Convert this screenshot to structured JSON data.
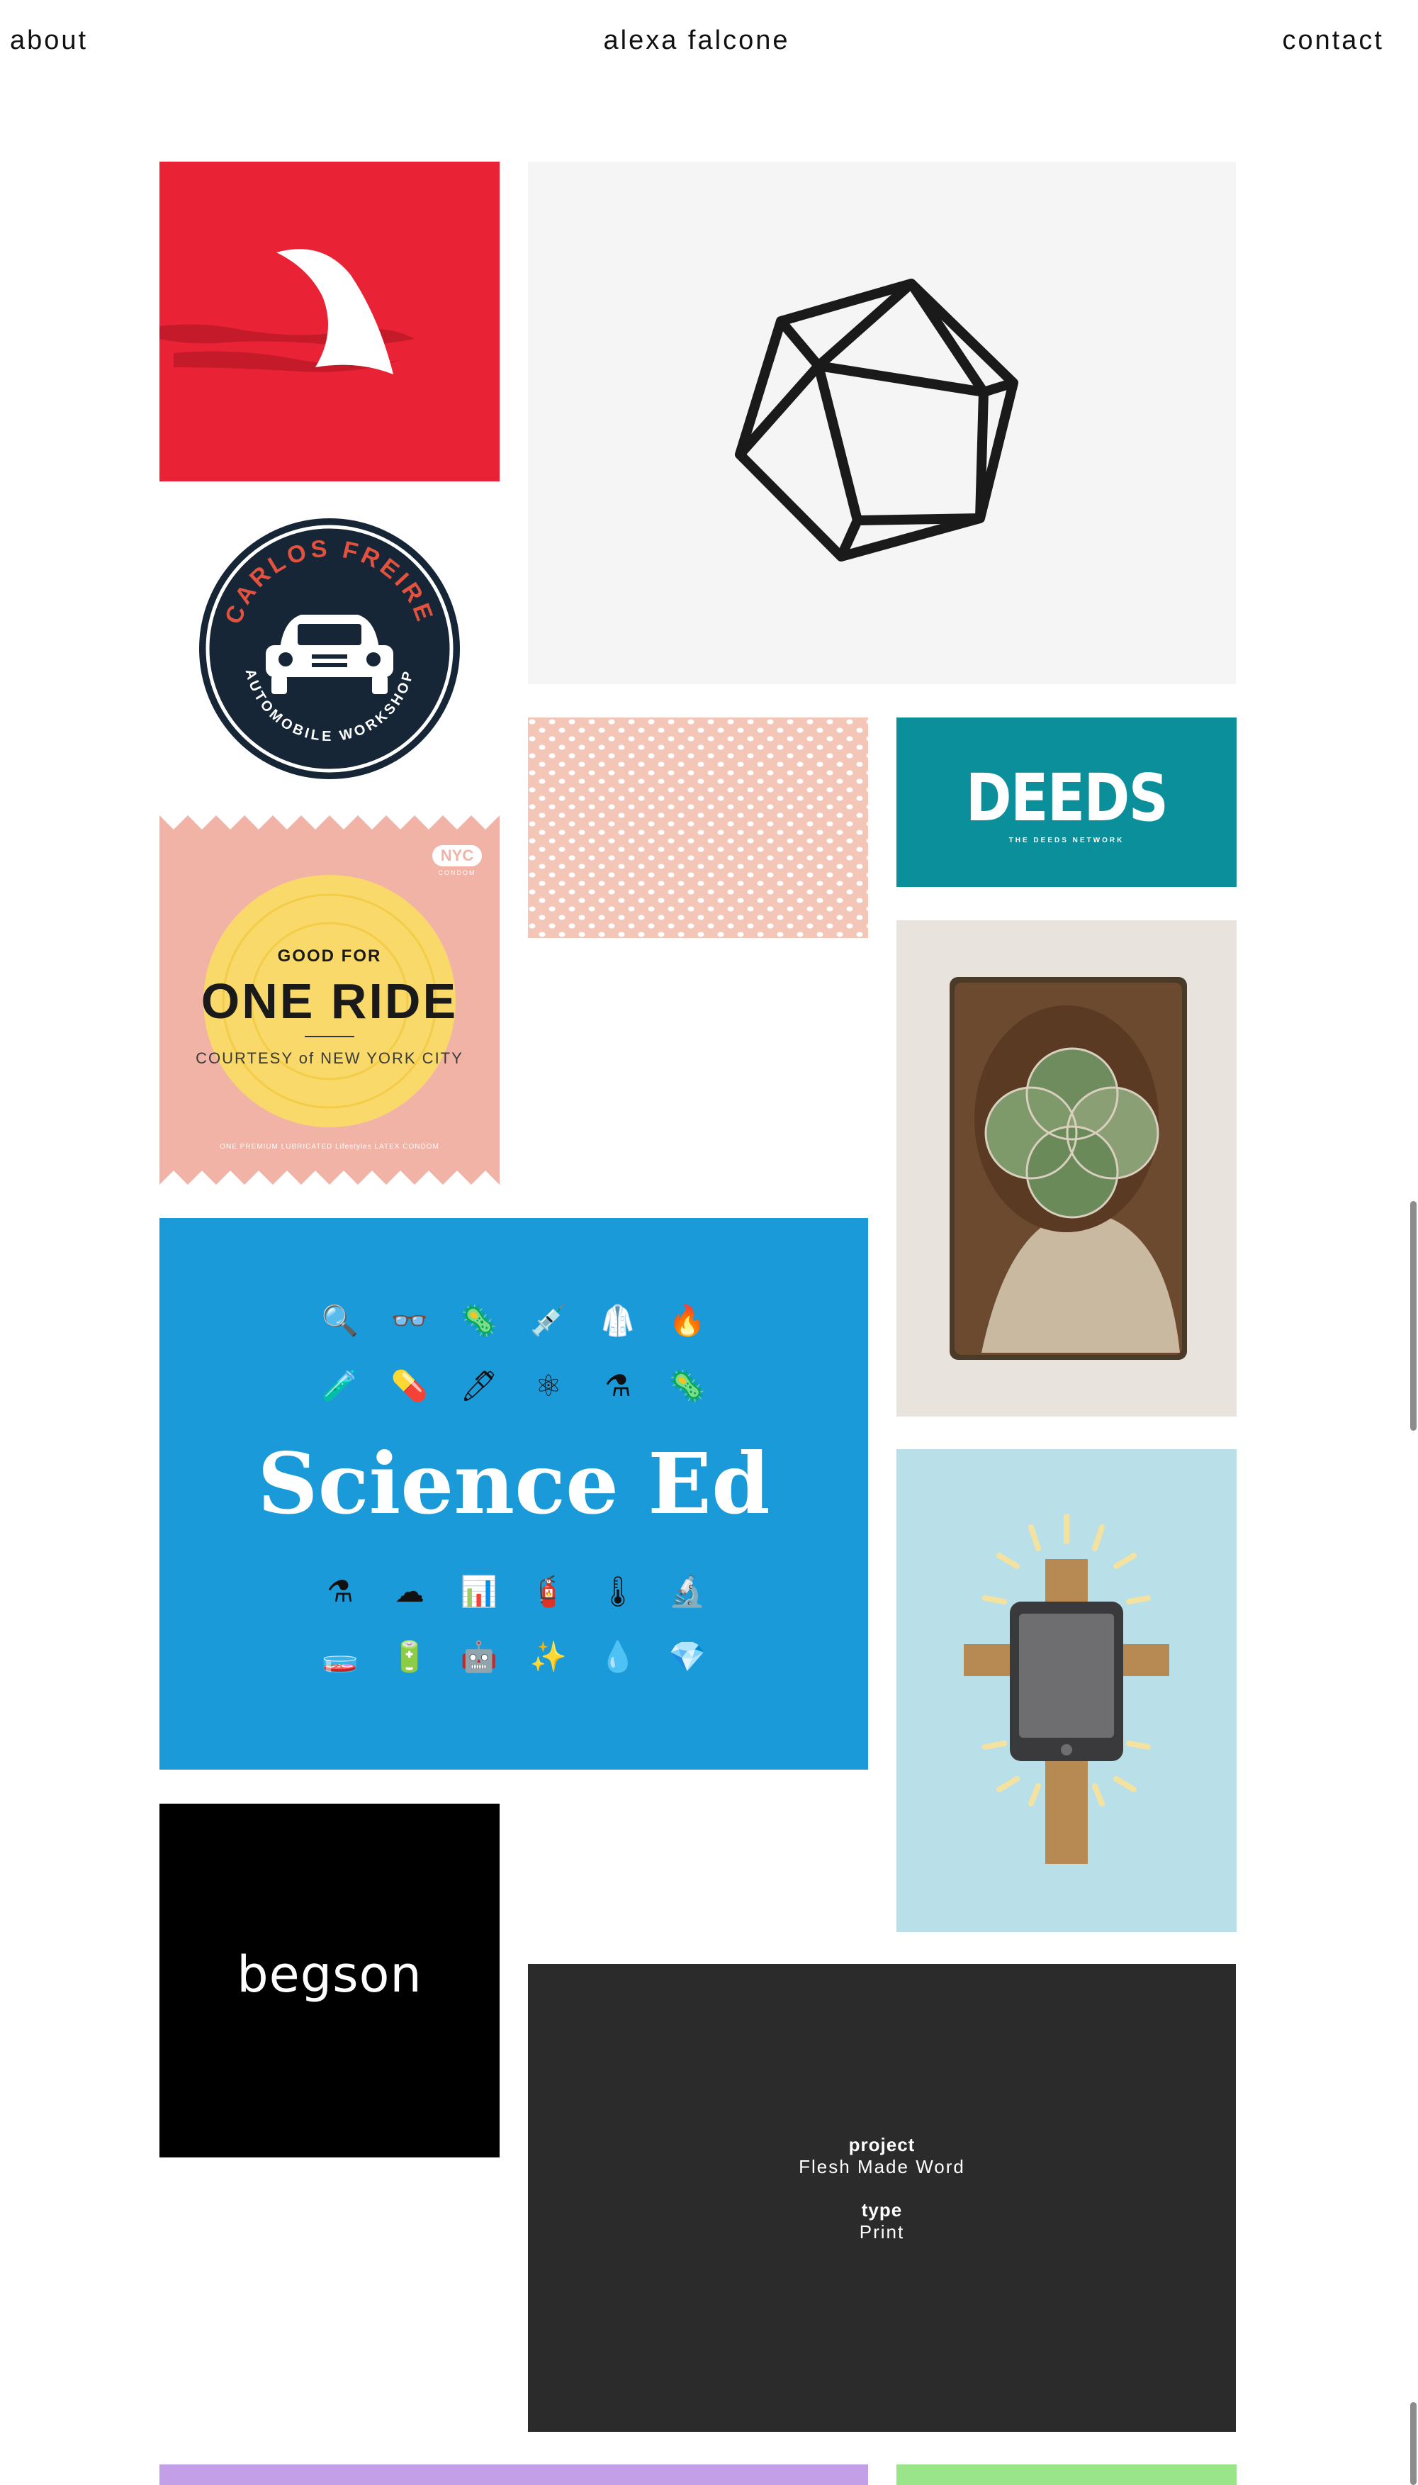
{
  "header": {
    "about": "about",
    "title": "alexa falcone",
    "contact": "contact"
  },
  "tiles": {
    "carlos": {
      "top": "CARLOS FREIRE",
      "bottom": "AUTOMOBILE WORKSHOP"
    },
    "deeds": {
      "title": "DEEDS",
      "subtitle": "THE DEEDS NETWORK"
    },
    "ride": {
      "badge": "NYC",
      "badge_sub": "CONDOM",
      "good_for": "GOOD FOR",
      "one_ride": "ONE RIDE",
      "courtesy": "COURTESY of NEW YORK CITY",
      "footer": "ONE PREMIUM LUBRICATED Lifestyles LATEX CONDOM"
    },
    "science": {
      "title": "Science Ed",
      "icons_row1": [
        "🔍",
        "👓",
        "🦠",
        "💉",
        "🥼",
        "🔥"
      ],
      "icons_row2": [
        "🧪",
        "💊",
        "🖊",
        "⚛",
        "⚗",
        "🦠"
      ],
      "icons_row3": [
        "⚗",
        "☁",
        "📊",
        "🧯",
        "🌡",
        "🔬"
      ],
      "icons_row4": [
        "🧫",
        "🔋",
        "🤖",
        "✨",
        "💧",
        "💎"
      ]
    },
    "begson": {
      "title": "begson"
    },
    "flesh": {
      "project_label": "project",
      "project_value": "Flesh Made Word",
      "type_label": "type",
      "type_value": "Print"
    }
  },
  "colors": {
    "shark_red": "#e92235",
    "deeds_teal": "#0b909b",
    "ride_pink": "#f2b3a7",
    "science_blue": "#1a9ad8",
    "cross_blue": "#b9dfe8",
    "flesh_dark": "#2b2b2b",
    "purple": "#c29fe6",
    "green": "#9ae58a"
  }
}
